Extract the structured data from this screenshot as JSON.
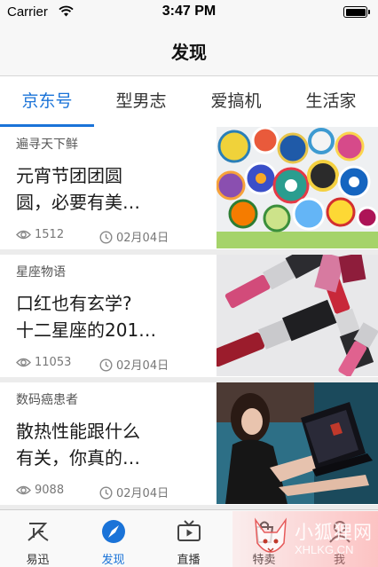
{
  "status_bar": {
    "carrier": "Carrier",
    "time": "3:47 PM"
  },
  "nav": {
    "title": "发现"
  },
  "tabs": [
    {
      "label": "京东号",
      "active": true
    },
    {
      "label": "型男志",
      "active": false
    },
    {
      "label": "爱搞机",
      "active": false
    },
    {
      "label": "生活家",
      "active": false
    }
  ],
  "articles": [
    {
      "source": "遍寻天下鲜",
      "title_lines": [
        "元宵节团团圆",
        "圆，必要有美…"
      ],
      "views": "1512",
      "date": "02月04日",
      "thumbnail": "decorative-plates-photo"
    },
    {
      "source": "星座物语",
      "title_lines": [
        "口红也有玄学?",
        "十二星座的201…"
      ],
      "views": "11053",
      "date": "02月04日",
      "thumbnail": "lipsticks-photo"
    },
    {
      "source": "数码癌患者",
      "title_lines": [
        "散热性能跟什么",
        "有关，你真的…"
      ],
      "views": "9088",
      "date": "02月04日",
      "thumbnail": "woman-with-laptop-photo"
    }
  ],
  "tabbar": [
    {
      "label": "易迅",
      "icon": "yixun-icon",
      "active": false
    },
    {
      "label": "发现",
      "icon": "compass-icon",
      "active": true
    },
    {
      "label": "直播",
      "icon": "tv-icon",
      "active": false
    },
    {
      "label": "特卖",
      "icon": "bag-icon",
      "active": false
    },
    {
      "label": "我",
      "icon": "person-icon",
      "active": false
    }
  ],
  "watermark": {
    "text": "小狐狸网",
    "sub": "XHLKG.CN"
  },
  "colors": {
    "accent": "#1a73d8",
    "divider": "#ececec",
    "bar_bg": "#f7f7f7"
  }
}
